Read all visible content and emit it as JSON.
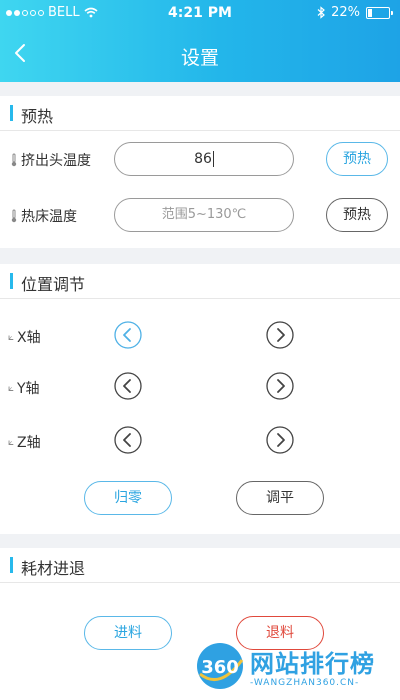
{
  "status": {
    "carrier": "BELL",
    "time": "4:21 PM",
    "battery": "22%"
  },
  "nav": {
    "title": "设置"
  },
  "preheat": {
    "section_title": "预热",
    "nozzle": {
      "label": "挤出头温度",
      "value": "86",
      "button": "预热"
    },
    "bed": {
      "label": "热床温度",
      "placeholder": "范围5~130℃",
      "button": "预热"
    }
  },
  "position": {
    "section_title": "位置调节",
    "axes": [
      {
        "label": "X轴"
      },
      {
        "label": "Y轴"
      },
      {
        "label": "Z轴"
      }
    ],
    "home_button": "归零",
    "level_button": "调平"
  },
  "filament": {
    "section_title": "耗材进退",
    "load_button": "进料",
    "unload_button": "退料"
  },
  "watermark": {
    "brand_text": "网站排行榜",
    "sub_text": "-WANGZHAN360.CN-"
  },
  "colors": {
    "accent": "#27b9ec",
    "danger": "#e0493c"
  }
}
